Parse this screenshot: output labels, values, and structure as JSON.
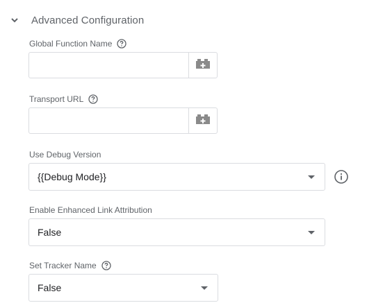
{
  "section": {
    "title": "Advanced Configuration",
    "icon": "chevron-down-icon"
  },
  "fields": {
    "global_function_name": {
      "label": "Global Function Name",
      "value": "",
      "help_icon": "help-circle-icon",
      "variable_icon": "variable-brick-icon"
    },
    "transport_url": {
      "label": "Transport URL",
      "value": "",
      "help_icon": "help-circle-icon",
      "variable_icon": "variable-brick-icon"
    },
    "use_debug_version": {
      "label": "Use Debug Version",
      "selected": "{{Debug Mode}}",
      "info_icon": "info-icon"
    },
    "enable_enhanced_link_attribution": {
      "label": "Enable Enhanced Link Attribution",
      "selected": "False"
    },
    "set_tracker_name": {
      "label": "Set Tracker Name",
      "selected": "False",
      "help_icon": "help-circle-icon"
    }
  },
  "colors": {
    "label_text": "#5f6368",
    "border": "#dadce0",
    "icon_gray": "#5f6368"
  }
}
